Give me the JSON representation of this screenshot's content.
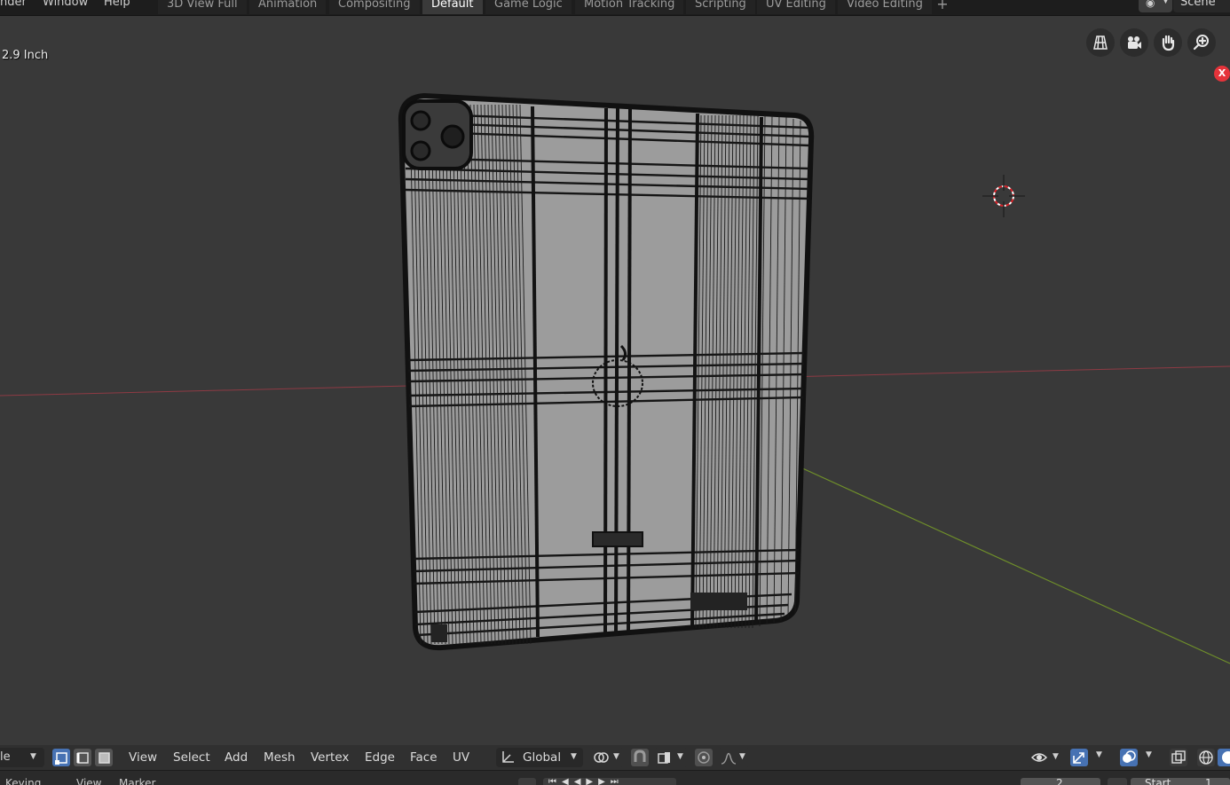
{
  "topbar": {
    "menus": [
      "nder",
      "Window",
      "Help"
    ],
    "tabs": [
      {
        "label": "3D View Full",
        "active": false
      },
      {
        "label": "Animation",
        "active": false
      },
      {
        "label": "Compositing",
        "active": false
      },
      {
        "label": "Default",
        "active": true
      },
      {
        "label": "Game Logic",
        "active": false
      },
      {
        "label": "Motion Tracking",
        "active": false
      },
      {
        "label": "Scripting",
        "active": false
      },
      {
        "label": "UV Editing",
        "active": false
      },
      {
        "label": "Video Editing",
        "active": false
      }
    ],
    "add_tab": "+",
    "scene_name": "Scene"
  },
  "viewport": {
    "object_label": "2.9 Inch",
    "close_badge": "X",
    "nav_icons": [
      "grid-view-icon",
      "camera-icon",
      "hand-pan-icon",
      "zoom-icon"
    ]
  },
  "header": {
    "mode_label": "le",
    "menus": [
      "View",
      "Select",
      "Add",
      "Mesh",
      "Vertex",
      "Edge",
      "Face",
      "UV"
    ],
    "transform_orientation": "Global"
  },
  "timeline": {
    "items": [
      "Keying",
      "View",
      "Marker"
    ],
    "frame_current": "2",
    "start_label": "Start",
    "start_value": "1"
  },
  "colors": {
    "accent_blue": "#4772b3",
    "x_axis": "#8e3a44",
    "y_axis": "#6f8f2a",
    "close_red": "#e5333a"
  }
}
